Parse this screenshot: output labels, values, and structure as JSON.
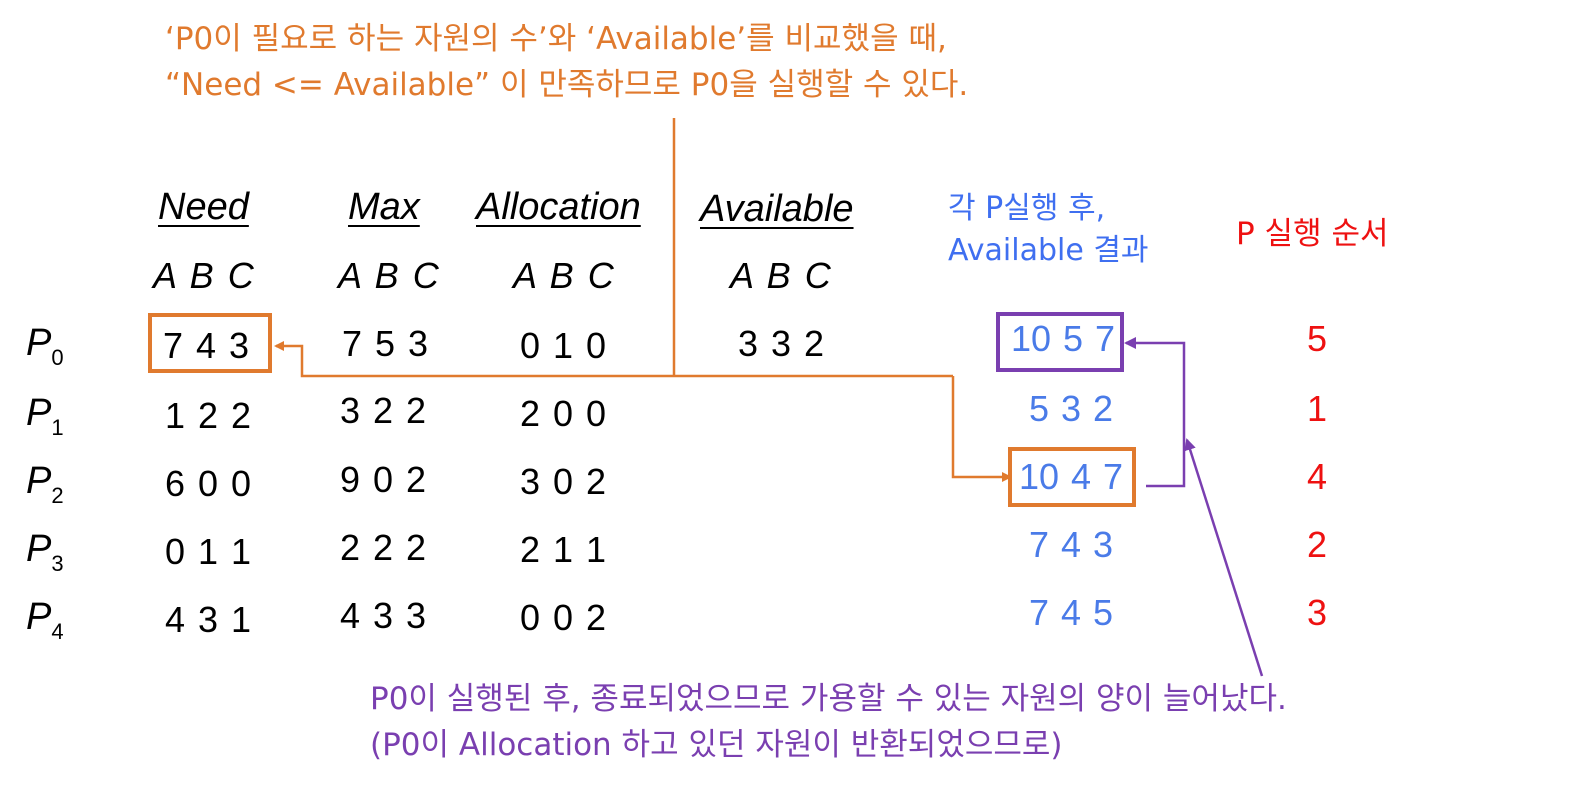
{
  "top_note": {
    "line1": "‘P0이 필요로 하는 자원의 수’와 ‘Available’를 비교했을 때,",
    "line2": "“Need <= Available” 이 만족하므로 P0을 실행할 수 있다."
  },
  "table": {
    "headers": {
      "need": "Need",
      "max": "Max",
      "allocation": "Allocation",
      "available": "Available"
    },
    "subheader": "A B C",
    "available_value": "3 3 2",
    "rows": [
      {
        "process": "P",
        "sub": "0",
        "need": "7 4 3",
        "max": "7 5 3",
        "allocation": "0 1 0"
      },
      {
        "process": "P",
        "sub": "1",
        "need": "1 2 2",
        "max": "3 2 2",
        "allocation": "2 0 0"
      },
      {
        "process": "P",
        "sub": "2",
        "need": "6 0 0",
        "max": "9 0 2",
        "allocation": "3 0 2"
      },
      {
        "process": "P",
        "sub": "3",
        "need": "0 1 1",
        "max": "2 2 2",
        "allocation": "2 1 1"
      },
      {
        "process": "P",
        "sub": "4",
        "need": "4 3 1",
        "max": "4 3 3",
        "allocation": "0 0 2"
      }
    ]
  },
  "available_after": {
    "header_line1": "각 P실행 후,",
    "header_line2": "Available 결과",
    "values": [
      "10 5 7",
      "5 3 2",
      "10 4 7",
      "7 4 3",
      "7 4 5"
    ]
  },
  "execution_order": {
    "header": "P 실행 순서",
    "values": [
      "5",
      "1",
      "4",
      "2",
      "3"
    ]
  },
  "bottom_note": {
    "line1": "P0이 실행된 후, 종료되었으므로 가용할 수 있는 자원의 양이 늘어났다.",
    "line2": "(P0이 Allocation 하고 있던 자원이 반환되었으므로)"
  },
  "colors": {
    "orange": "#e07a2e",
    "purple": "#7a3fb0",
    "blue": "#4a7be8",
    "red": "#ee1111"
  }
}
